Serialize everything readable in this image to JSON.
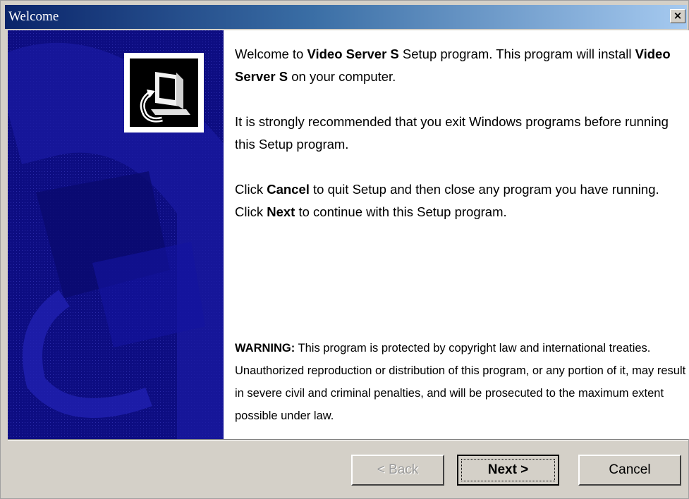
{
  "window": {
    "title": "Welcome",
    "close_glyph": "×"
  },
  "content": {
    "para1": {
      "t1": "Welcome to ",
      "b1": "Video Server S",
      "t2": " Setup program. This program will install ",
      "b2": "Video Server S",
      "t3": " on your computer."
    },
    "para2": "It is strongly recommended that you exit Windows programs before running this Setup program.",
    "para3": {
      "t1": "Click ",
      "b1": "Cancel",
      "t2": " to quit Setup and then close any program you have running. Click ",
      "b2": "Next",
      "t3": " to continue with this Setup program."
    },
    "warning": {
      "label": "WARNING:",
      "text": " This program is protected by copyright law and international treaties. Unauthorized reproduction or distribution of this program, or any portion of it, may result in severe civil and criminal penalties, and will be prosecuted to the maximum extent possible under law."
    }
  },
  "buttons": {
    "back": "< Back",
    "next": "Next >",
    "cancel": "Cancel"
  },
  "icons": {
    "logo": "computer-setup-icon",
    "close": "close-icon"
  },
  "colors": {
    "side_panel": "#0d0d82",
    "title_bar_start": "#0a246a",
    "title_bar_end": "#a6caf0",
    "dialog_bg": "#d4d0c8"
  }
}
